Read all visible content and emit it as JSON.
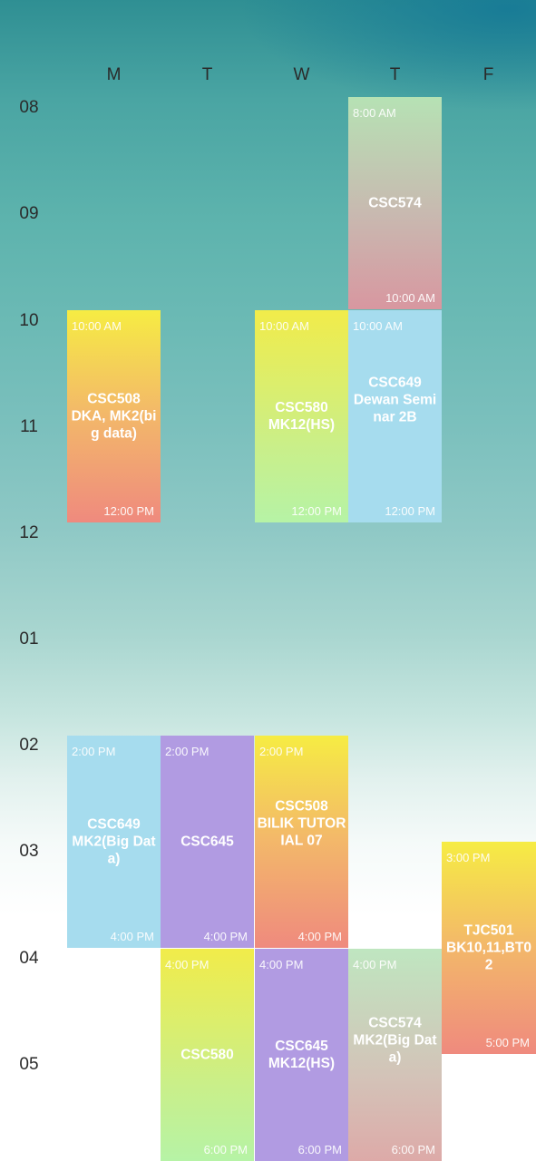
{
  "days": [
    "M",
    "T",
    "W",
    "T",
    "F"
  ],
  "hours": [
    "08",
    "09",
    "10",
    "11",
    "12",
    "01",
    "02",
    "03",
    "04",
    "05"
  ],
  "events": [
    {
      "name": "event-thu-csc574-am",
      "start": "8:00 AM",
      "end": "10:00 AM",
      "label": "CSC574"
    },
    {
      "name": "event-mon-csc508",
      "start": "10:00 AM",
      "end": "12:00 PM",
      "label": "CSC508\nDKA, MK2(big data)"
    },
    {
      "name": "event-wed-csc580-am",
      "start": "10:00 AM",
      "end": "12:00 PM",
      "label": "CSC580\nMK12(HS)"
    },
    {
      "name": "event-thu-csc649",
      "start": "10:00 AM",
      "end": "12:00 PM",
      "label": "CSC649\nDewan Seminar 2B"
    },
    {
      "name": "event-mon-csc649",
      "start": "2:00 PM",
      "end": "4:00 PM",
      "label": "CSC649\nMK2(Big Data)"
    },
    {
      "name": "event-tue-csc645",
      "start": "2:00 PM",
      "end": "4:00 PM",
      "label": "CSC645"
    },
    {
      "name": "event-wed-csc508",
      "start": "2:00 PM",
      "end": "4:00 PM",
      "label": "CSC508\nBILIK TUTORIAL 07"
    },
    {
      "name": "event-fri-tjc501",
      "start": "3:00 PM",
      "end": "5:00 PM",
      "label": "TJC501\nBK10,11,BT02"
    },
    {
      "name": "event-tue-csc580",
      "start": "4:00 PM",
      "end": "6:00 PM",
      "label": "CSC580"
    },
    {
      "name": "event-wed-csc645",
      "start": "4:00 PM",
      "end": "6:00 PM",
      "label": "CSC645\nMK12(HS)"
    },
    {
      "name": "event-thu-csc574-pm",
      "start": "4:00 PM",
      "end": "6:00 PM",
      "label": "CSC574\nMK2(Big Data)"
    }
  ]
}
